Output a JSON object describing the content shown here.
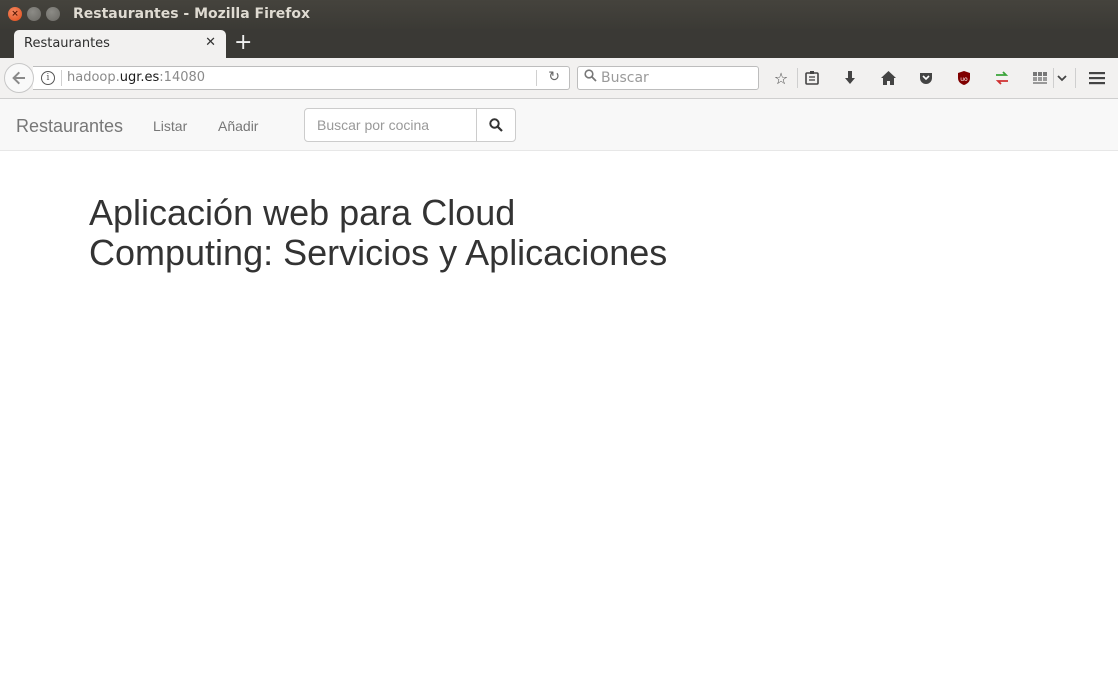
{
  "window": {
    "title": "Restaurantes - Mozilla Firefox"
  },
  "tabs": [
    {
      "label": "Restaurantes"
    }
  ],
  "urlbar": {
    "prefix": "hadoop.",
    "domain": "ugr.es",
    "suffix": ":14080"
  },
  "browser_search": {
    "placeholder": "Buscar"
  },
  "site_nav": {
    "brand": "Restaurantes",
    "links": [
      {
        "label": "Listar"
      },
      {
        "label": "Añadir"
      }
    ],
    "search_placeholder": "Buscar por cocina"
  },
  "main": {
    "heading_line1": "Aplicación web para Cloud",
    "heading_line2": "Computing: Servicios y Aplicaciones"
  },
  "toolbar_icons": [
    "bookmark-star-icon",
    "reading-list-icon",
    "download-icon",
    "home-icon",
    "pocket-icon",
    "ublock-icon",
    "sync-arrows-icon",
    "library-icon",
    "overflow-chevron-icon",
    "hamburger-menu-icon"
  ]
}
